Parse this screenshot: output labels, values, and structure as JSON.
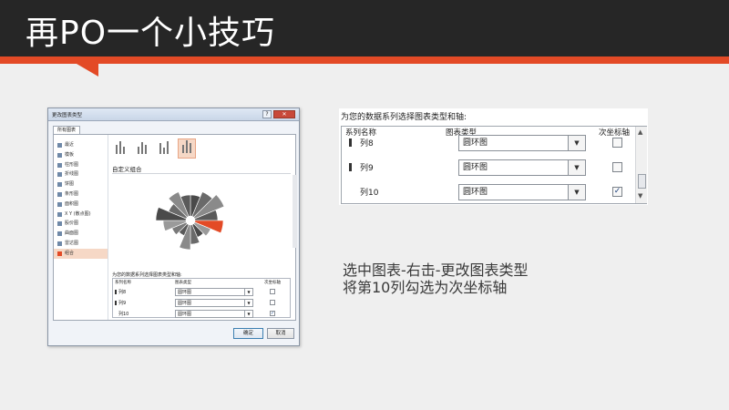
{
  "slide": {
    "title": "再PO一个小技巧",
    "accent": "#e34a26",
    "header_bg": "#262626",
    "instruction_lines": [
      "选中图表-右击-更改图表类型",
      "将第10列勾选为次坐标轴"
    ]
  },
  "dialog": {
    "title": "更改图表类型",
    "help_glyph": "?",
    "close_glyph": "✕",
    "tab": "所有图表",
    "sidebar": [
      {
        "label": "最近",
        "icon": "recent-icon"
      },
      {
        "label": "模板",
        "icon": "template-icon"
      },
      {
        "label": "柱形图",
        "icon": "column-chart-icon"
      },
      {
        "label": "折线图",
        "icon": "line-chart-icon"
      },
      {
        "label": "饼图",
        "icon": "pie-chart-icon"
      },
      {
        "label": "条形图",
        "icon": "bar-chart-icon"
      },
      {
        "label": "面积图",
        "icon": "area-chart-icon"
      },
      {
        "label": "X Y (散点图)",
        "icon": "scatter-chart-icon"
      },
      {
        "label": "股价图",
        "icon": "stock-chart-icon"
      },
      {
        "label": "曲面图",
        "icon": "surface-chart-icon"
      },
      {
        "label": "雷达图",
        "icon": "radar-chart-icon"
      },
      {
        "label": "组合",
        "icon": "combo-chart-icon",
        "selected": true
      }
    ],
    "subtype_label": "自定义组合",
    "series_label": "为您的数据系列选择图表类型和轴:",
    "columns": {
      "name": "系列名称",
      "type": "图表类型",
      "axis": "次坐标轴"
    },
    "rows": [
      {
        "name": "列8",
        "type": "圆环图",
        "secondary": false,
        "marker": true
      },
      {
        "name": "列9",
        "type": "圆环图",
        "secondary": false,
        "marker": true
      },
      {
        "name": "列10",
        "type": "圆环图",
        "secondary": true,
        "marker": false
      }
    ],
    "ok": "确定",
    "cancel": "取消"
  },
  "zoom": {
    "label": "为您的数据系列选择图表类型和轴:",
    "columns": {
      "name": "系列名称",
      "type": "图表类型",
      "axis": "次坐标轴"
    },
    "rows": [
      {
        "name": "列8",
        "type": "圆环图",
        "secondary": false,
        "marker": true
      },
      {
        "name": "列9",
        "type": "圆环图",
        "secondary": false,
        "marker": true
      },
      {
        "name": "列10",
        "type": "圆环图",
        "secondary": true,
        "marker": false
      }
    ],
    "dropdown_glyph": "▼",
    "check_glyph": "✓"
  }
}
